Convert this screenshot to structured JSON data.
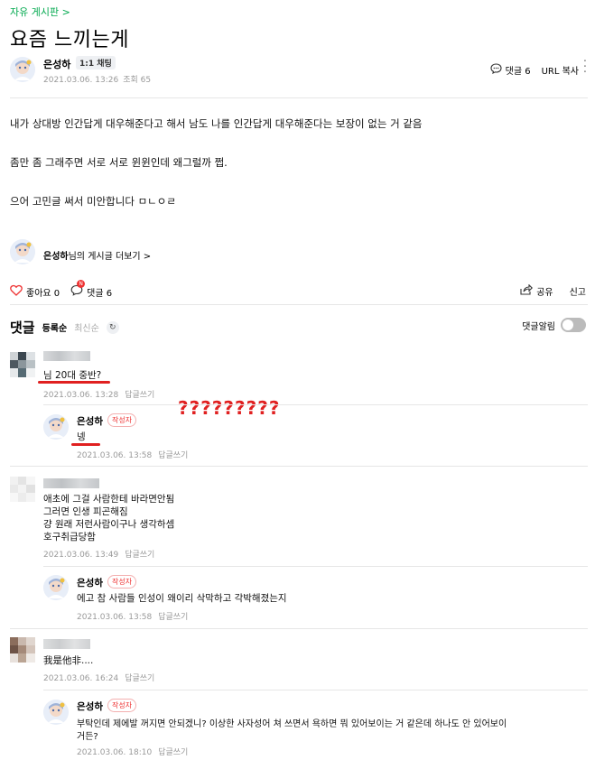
{
  "breadcrumb": "자유 게시판 >",
  "post": {
    "title": "요즘 느끼는게",
    "author": "은성하",
    "chat_badge": "1:1 채팅",
    "date": "2021.03.06. 13:26",
    "views": "조회 65",
    "comment_count_label": "댓글 6",
    "url_copy": "URL 복사",
    "body": [
      "내가 상대방 인간답게 대우해준다고 해서 남도 나를 인간답게 대우해준다는 보장이 없는 거 같음",
      "좀만 좀 그래주면 서로 서로 윈윈인데 왜그럴까 쩝.",
      "으어 고민글 써서 미안합니다 ㅁㄴㅇㄹ"
    ],
    "more_posts_name": "은성하",
    "more_posts_suffix": "님의 게시글 더보기 >"
  },
  "actions": {
    "like": "좋아요 0",
    "comment": "댓글 6",
    "share": "공유",
    "report": "신고",
    "new_badge": "N"
  },
  "comments_header": {
    "title": "댓글",
    "sort_active": "등록순",
    "sort_inactive": "최신순",
    "alarm": "댓글알림"
  },
  "comments": [
    {
      "text": "님 20대 중반?",
      "date": "2021.03.06. 13:28",
      "reply": "답글쓰기"
    },
    {
      "name": "은성하",
      "badge": "작성자",
      "text": "넹",
      "date": "2021.03.06. 13:58",
      "reply": "답글쓰기"
    },
    {
      "lines": [
        "애초에 그걸 사람한테 바라면안됨",
        "그러면 인생 피곤해짐",
        "걍 원래 저런사람이구나 생각하셈",
        "호구취급당함"
      ],
      "date": "2021.03.06. 13:49",
      "reply": "답글쓰기"
    },
    {
      "name": "은성하",
      "badge": "작성자",
      "text": "에고 참 사람들 인성이 왜이리 삭막하고 각박해졌는지",
      "date": "2021.03.06. 13:58",
      "reply": "답글쓰기"
    },
    {
      "text": "我是他非....",
      "date": "2021.03.06. 16:24",
      "reply": "답글쓰기"
    },
    {
      "name": "은성하",
      "badge": "작성자",
      "lines": [
        "부탁인데 제에발 꺼지면 안되겠니? 이상한 사자성어 쳐 쓰면서 욕하면 뭐 있어보이는 거 같은데 하나도 안 있어보이",
        "거든?"
      ],
      "date": "2021.03.06. 18:10",
      "reply": "답글쓰기"
    }
  ],
  "annotation": "?????????",
  "colors": {
    "accent_green": "#03a94f",
    "annotation_red": "#e02020",
    "badge_red": "#e33333"
  },
  "icons": [
    "comment-icon",
    "more-icon",
    "heart-icon",
    "share-icon",
    "refresh-icon"
  ]
}
